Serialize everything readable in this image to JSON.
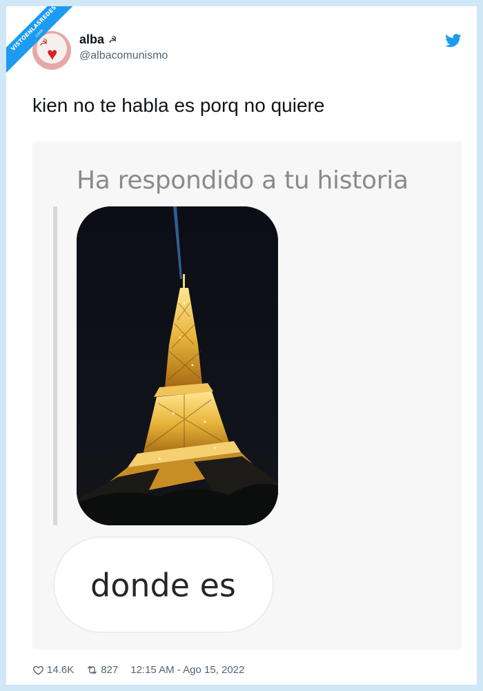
{
  "watermark": {
    "text": "VISTOENLASREDES",
    "sub": ".com"
  },
  "author": {
    "name": "alba",
    "name_emoji": "☭",
    "handle": "@albacomunismo",
    "avatar_icon": "avatar-heart-icon"
  },
  "tweet": {
    "text": "kien no te habla es porq no quiere"
  },
  "embedded": {
    "reply_label": "Ha respondido a tu historia",
    "story_image": "eiffel-tower-night",
    "message": "donde es"
  },
  "stats": {
    "likes": "14.6K",
    "retweets": "827",
    "timestamp": "12:15 AM - Ago 15, 2022"
  },
  "colors": {
    "brand": "#1d9bf0",
    "frame": "#cfe7f7",
    "muted": "#536471"
  }
}
